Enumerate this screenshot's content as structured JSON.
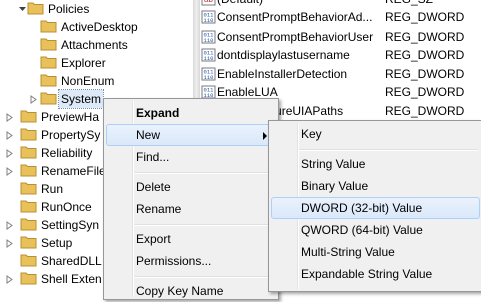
{
  "tree": {
    "items": [
      {
        "label": "Policies"
      },
      {
        "label": "ActiveDesktop"
      },
      {
        "label": "Attachments"
      },
      {
        "label": "Explorer"
      },
      {
        "label": "NonEnum"
      },
      {
        "label": "System"
      },
      {
        "label": "PreviewHa"
      },
      {
        "label": "PropertySy"
      },
      {
        "label": "Reliability"
      },
      {
        "label": "RenameFile"
      },
      {
        "label": "Run"
      },
      {
        "label": "RunOnce"
      },
      {
        "label": "SettingSyn"
      },
      {
        "label": "Setup"
      },
      {
        "label": "SharedDLL"
      },
      {
        "label": "Shell Exten"
      }
    ]
  },
  "values": {
    "rows": [
      {
        "name": "(Default)",
        "type": "REG_SZ"
      },
      {
        "name": "ConsentPromptBehaviorAd...",
        "type": "REG_DWORD"
      },
      {
        "name": "ConsentPromptBehaviorUser",
        "type": "REG_DWORD"
      },
      {
        "name": "dontdisplaylastusername",
        "type": "REG_DWORD"
      },
      {
        "name": "EnableInstallerDetection",
        "type": "REG_DWORD"
      },
      {
        "name": "EnableLUA",
        "type": "REG_DWORD"
      },
      {
        "name": "EnableSecureUIAPaths",
        "type": "REG_DWORD"
      }
    ]
  },
  "context_menu": {
    "expand": "Expand",
    "new": "New",
    "find": "Find...",
    "delete": "Delete",
    "rename": "Rename",
    "export": "Export",
    "permissions": "Permissions...",
    "copy_key_name": "Copy Key Name"
  },
  "submenu": {
    "key": "Key",
    "string_value": "String Value",
    "binary_value": "Binary Value",
    "dword_value": "DWORD (32-bit) Value",
    "qword_value": "QWORD (64-bit) Value",
    "multi_string_value": "Multi-String Value",
    "expandable_string_value": "Expandable String Value"
  },
  "colors": {
    "folder": "#e8c15a",
    "selection": "#dde9f7",
    "menu_background": "#f0f0f0",
    "highlight": "#d9e8fa"
  }
}
